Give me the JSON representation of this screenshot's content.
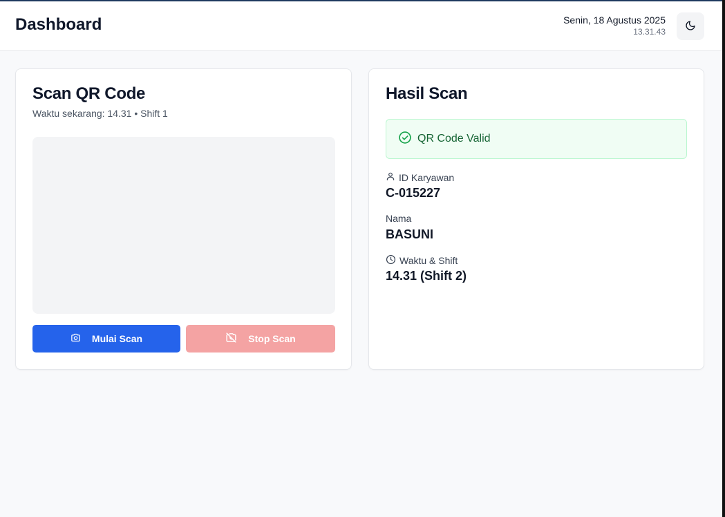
{
  "header": {
    "title": "Dashboard",
    "date": "Senin, 18 Agustus 2025",
    "time": "13.31.43",
    "theme_toggle_icon": "moon-icon"
  },
  "scanner": {
    "title": "Scan QR Code",
    "subtitle": "Waktu sekarang: 14.31 • Shift 1",
    "start_label": "Mulai Scan",
    "start_icon": "camera-icon",
    "stop_label": "Stop Scan",
    "stop_icon": "camera-off-icon"
  },
  "result": {
    "title": "Hasil Scan",
    "status_text": "QR Code Valid",
    "status_icon": "check-circle-icon",
    "fields": [
      {
        "label": "ID Karyawan",
        "value": "C-015227",
        "icon": "user-icon"
      },
      {
        "label": "Nama",
        "value": "BASUNI"
      },
      {
        "label": "Waktu & Shift",
        "value": "14.31 (Shift 2)",
        "icon": "clock-icon"
      }
    ]
  },
  "colors": {
    "primary": "#2563eb",
    "stop_disabled": "#f4a3a3",
    "success_text": "#166534",
    "success_bg": "#f0fdf4",
    "success_border": "#bbf7d0"
  }
}
